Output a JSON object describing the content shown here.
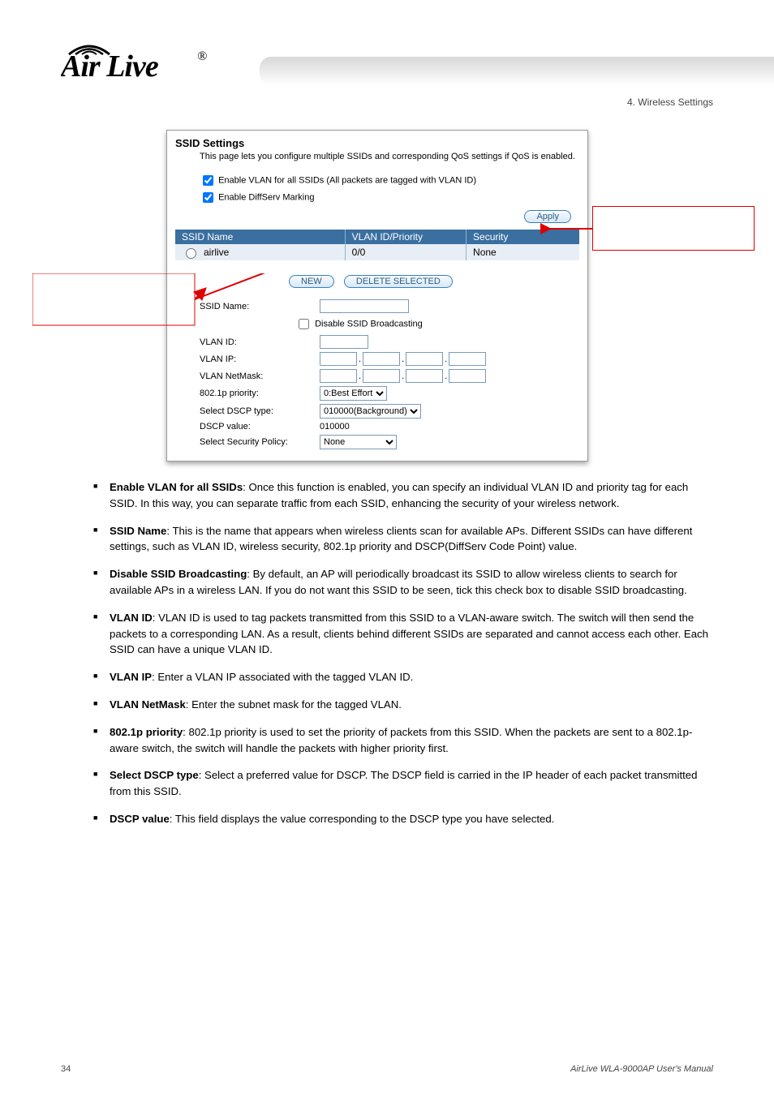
{
  "brand": "Air Live",
  "registered": "®",
  "chapter_label": "4. Wireless Settings",
  "panel": {
    "title": "SSID Settings",
    "desc": "This page lets you configure multiple SSIDs and corresponding QoS settings if QoS is enabled.",
    "chk_vlan": "Enable VLAN for all SSIDs (All packets are tagged with VLAN ID)",
    "chk_diffserv": "Enable DiffServ Marking",
    "apply": "Apply",
    "th_name": "SSID  Name",
    "th_vlan": "VLAN ID/Priority",
    "th_sec": "Security",
    "row_name": "airlive",
    "row_vlan": "0/0",
    "row_sec": "None",
    "new_btn": "NEW",
    "del_btn": "DELETE SELECTED",
    "f_ssid": "SSID Name:",
    "f_disable_bcast": "Disable SSID Broadcasting",
    "f_vlanid": "VLAN ID:",
    "f_vlanip": "VLAN IP:",
    "f_vlanmask": "VLAN NetMask:",
    "f_8021p": "802.1p priority:",
    "sel_8021p": "0:Best Effort",
    "f_dscp_type": "Select DSCP type:",
    "sel_dscp": "010000(Background)",
    "f_dscp_val": "DSCP value:",
    "dscp_val": "010000",
    "f_secpol": "Select Security Policy:",
    "sel_secpol": "None"
  },
  "bullets": [
    {
      "label": "Enable VLAN for all SSIDs",
      "text": ": Once this function is enabled, you can specify an individual VLAN ID and priority tag for each SSID. In this way, you can separate traffic from each SSID, enhancing the security of your wireless network."
    },
    {
      "label": "SSID Name",
      "text": ": This is the name that appears when wireless clients scan for available APs. Different SSIDs can have different settings, such as VLAN ID, wireless security, 802.1p priority and DSCP(DiffServ Code Point) value."
    },
    {
      "label": "Disable SSID Broadcasting",
      "text": ": By default, an AP will periodically broadcast its SSID to allow wireless clients to search for available APs in a wireless LAN. If you do not want this SSID to be seen, tick this check box to disable SSID broadcasting."
    },
    {
      "label": "VLAN ID",
      "text": ": VLAN ID is used to tag packets transmitted from this SSID to a VLAN-aware switch. The switch will then send the packets to a corresponding LAN. As a result, clients behind different SSIDs are separated and cannot access each other. Each SSID can have a unique VLAN ID."
    },
    {
      "label": "VLAN IP",
      "text": ": Enter a VLAN IP associated with the tagged VLAN ID."
    },
    {
      "label": "VLAN NetMask",
      "text": ": Enter the subnet mask for the tagged VLAN."
    },
    {
      "label": "802.1p priority",
      "text": ": 802.1p priority is used to set the priority of packets from this SSID. When the packets are sent to a 802.1p-aware switch, the switch will handle the packets with higher priority first."
    },
    {
      "label": "Select DSCP type",
      "text": ": Select a preferred value for DSCP. The DSCP field is carried in the IP header of each packet transmitted from this SSID."
    },
    {
      "label": "DSCP value",
      "text": ": This field displays the value corresponding to the DSCP type you have selected."
    }
  ],
  "footer_page": "34",
  "footer_model": "AirLive WLA-9000AP User's Manual"
}
